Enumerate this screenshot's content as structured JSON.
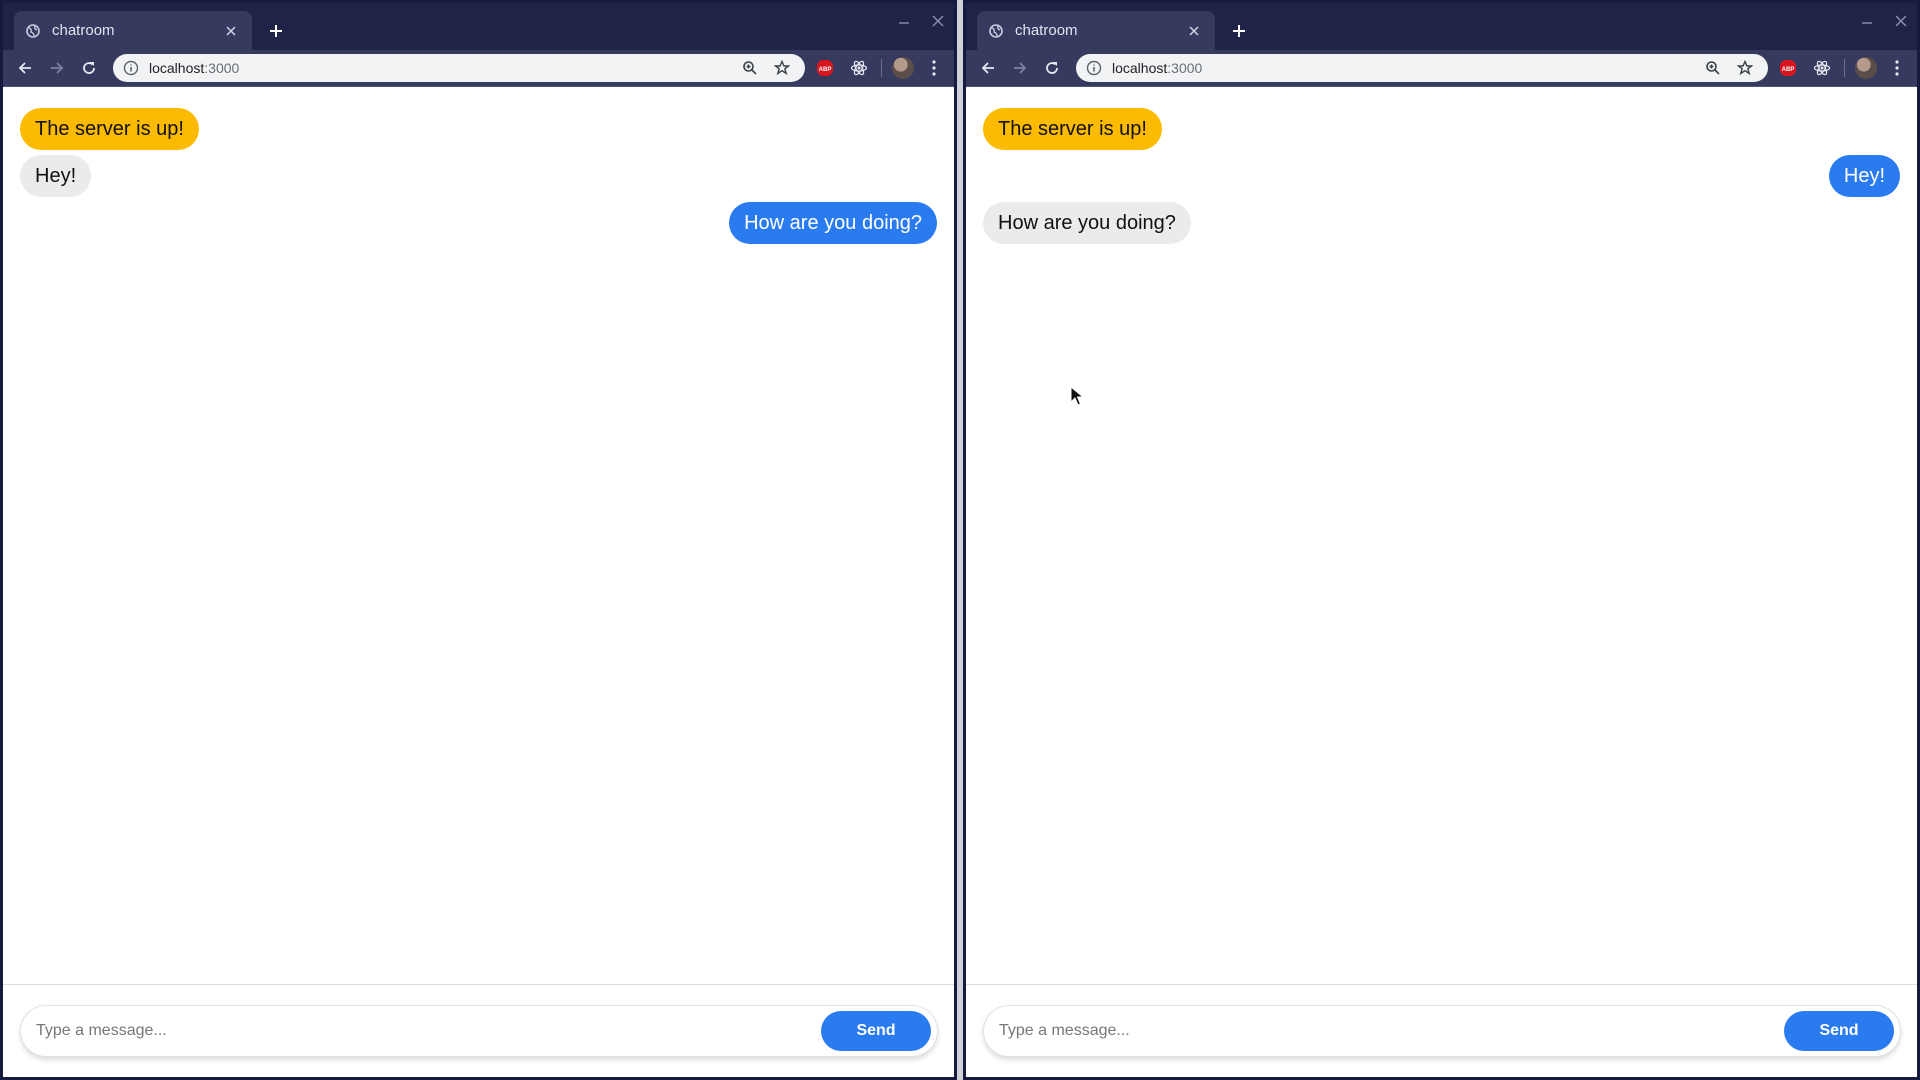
{
  "windows": [
    {
      "tab_title": "chatroom",
      "url_host": "localhost",
      "url_port": ":3000",
      "messages": [
        {
          "kind": "system",
          "text": "The server is up!",
          "side": "left"
        },
        {
          "kind": "received",
          "text": "Hey!",
          "side": "left"
        },
        {
          "kind": "sent",
          "text": "How are you doing?",
          "side": "right"
        }
      ],
      "input_placeholder": "Type a message...",
      "send_label": "Send"
    },
    {
      "tab_title": "chatroom",
      "url_host": "localhost",
      "url_port": ":3000",
      "messages": [
        {
          "kind": "system",
          "text": "The server is up!",
          "side": "left"
        },
        {
          "kind": "sent",
          "text": "Hey!",
          "side": "right"
        },
        {
          "kind": "received",
          "text": "How are you doing?",
          "side": "left"
        }
      ],
      "input_placeholder": "Type a message...",
      "send_label": "Send"
    }
  ],
  "extensions": [
    "adblock-plus-icon",
    "react-devtools-icon"
  ],
  "colors": {
    "titlebar": "#1e2347",
    "toolbar": "#353a5e",
    "system_bubble": "#fcbb00",
    "received_bubble": "#ebebeb",
    "sent_bubble": "#2b7bf0",
    "send_button": "#2b7bf0"
  }
}
